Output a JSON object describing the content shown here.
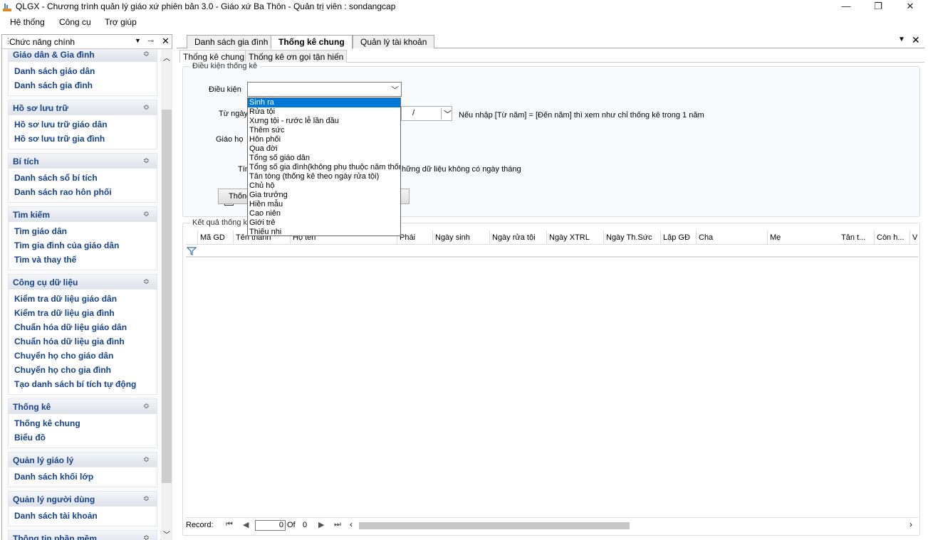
{
  "window": {
    "title": "QLGX - Chương trình quản lý giáo xứ phiên bản 3.0 - Giáo xứ Ba Thôn - Quản trị viên : sondangcap",
    "minimize": "—",
    "maximize": "❐",
    "close": "✕"
  },
  "menu": [
    "Hệ thống",
    "Công cụ",
    "Trợ giúp"
  ],
  "left_panel": {
    "title": "Chức năng chính",
    "groups": [
      {
        "title": "Giáo dân & Gia đình",
        "items": [
          "Danh sách giáo dân",
          "Danh sách gia đình"
        ]
      },
      {
        "title": "Hồ sơ lưu trữ",
        "items": [
          "Hồ sơ lưu trữ giáo dân",
          "Hồ sơ lưu trữ gia đình"
        ]
      },
      {
        "title": "Bí tích",
        "items": [
          "Danh sách sổ bí tích",
          "Danh sách rao hôn phối"
        ]
      },
      {
        "title": "Tìm kiếm",
        "items": [
          "Tìm giáo dân",
          "Tìm gia đình của giáo dân",
          "Tìm và thay thế"
        ]
      },
      {
        "title": "Công cụ dữ liệu",
        "items": [
          "Kiểm tra dữ liệu giáo dân",
          "Kiểm tra dữ liệu gia đình",
          "Chuẩn hóa dữ liệu giáo dân",
          "Chuẩn hóa dữ liệu gia đình",
          "Chuyển họ cho giáo dân",
          "Chuyển họ cho gia đình",
          "Tạo danh sách bí tích tự động"
        ]
      },
      {
        "title": "Thống kê",
        "items": [
          "Thống kê chung",
          "Biểu đồ"
        ]
      },
      {
        "title": "Quản lý giáo lý",
        "items": [
          "Danh sách khối lớp"
        ]
      },
      {
        "title": "Quản lý người dùng",
        "items": [
          "Danh sách tài khoản"
        ]
      },
      {
        "title": "Thông tin phần mềm",
        "items": []
      }
    ]
  },
  "doc_tabs": [
    "Danh sách gia đình",
    "Thống kê chung",
    "Quản lý tài khoản"
  ],
  "inner_tabs": [
    "Thống kê chung",
    "Thống kê ơn gọi tận hiến"
  ],
  "conditions": {
    "group_title": "Điều kiện thống kê",
    "dieu_kien_label": "Điều kiện",
    "dieu_kien_value": "",
    "tu_ngay_label": "Từ ngày",
    "date_value": "/",
    "note": "Nếu nhập [Từ năm] = [Đến năm] thì xem như chỉ thống kê trong 1 năm",
    "giao_ho_label": "Giáo họ",
    "checkbox_label_start": "Tính",
    "checkbox_label_end": "hững dữ liệu không có ngày tháng",
    "button_label": "Thống"
  },
  "dropdown_options": [
    "Sinh ra",
    "Rửa tội",
    "Xưng tội - rước lễ lần đầu",
    "Thêm sức",
    "Hôn phối",
    "Qua đời",
    "Tổng số giáo dân",
    "Tổng số gia đình(không phụ thuộc năm thống",
    "Tân tòng (thống kê theo ngày rửa tội)",
    "Chủ hộ",
    "Gia trưởng",
    "Hiền mẫu",
    "Cao niên",
    "Giới trẻ",
    "Thiếu nhi"
  ],
  "results": {
    "group_title": "Kết quả thống kê",
    "columns": [
      "Mã GD",
      "Tên thánh",
      "Họ tên",
      "Phái",
      "Ngày sinh",
      "Ngày rửa tội",
      "Ngày XTRL",
      "Ngày Th.Sức",
      "Lập GĐ",
      "Cha",
      "Mẹ",
      "Tân t...",
      "Còn h...",
      "V"
    ],
    "record_label": "Record:",
    "record_value": "0",
    "of_label": "Of",
    "of_value": "0"
  }
}
